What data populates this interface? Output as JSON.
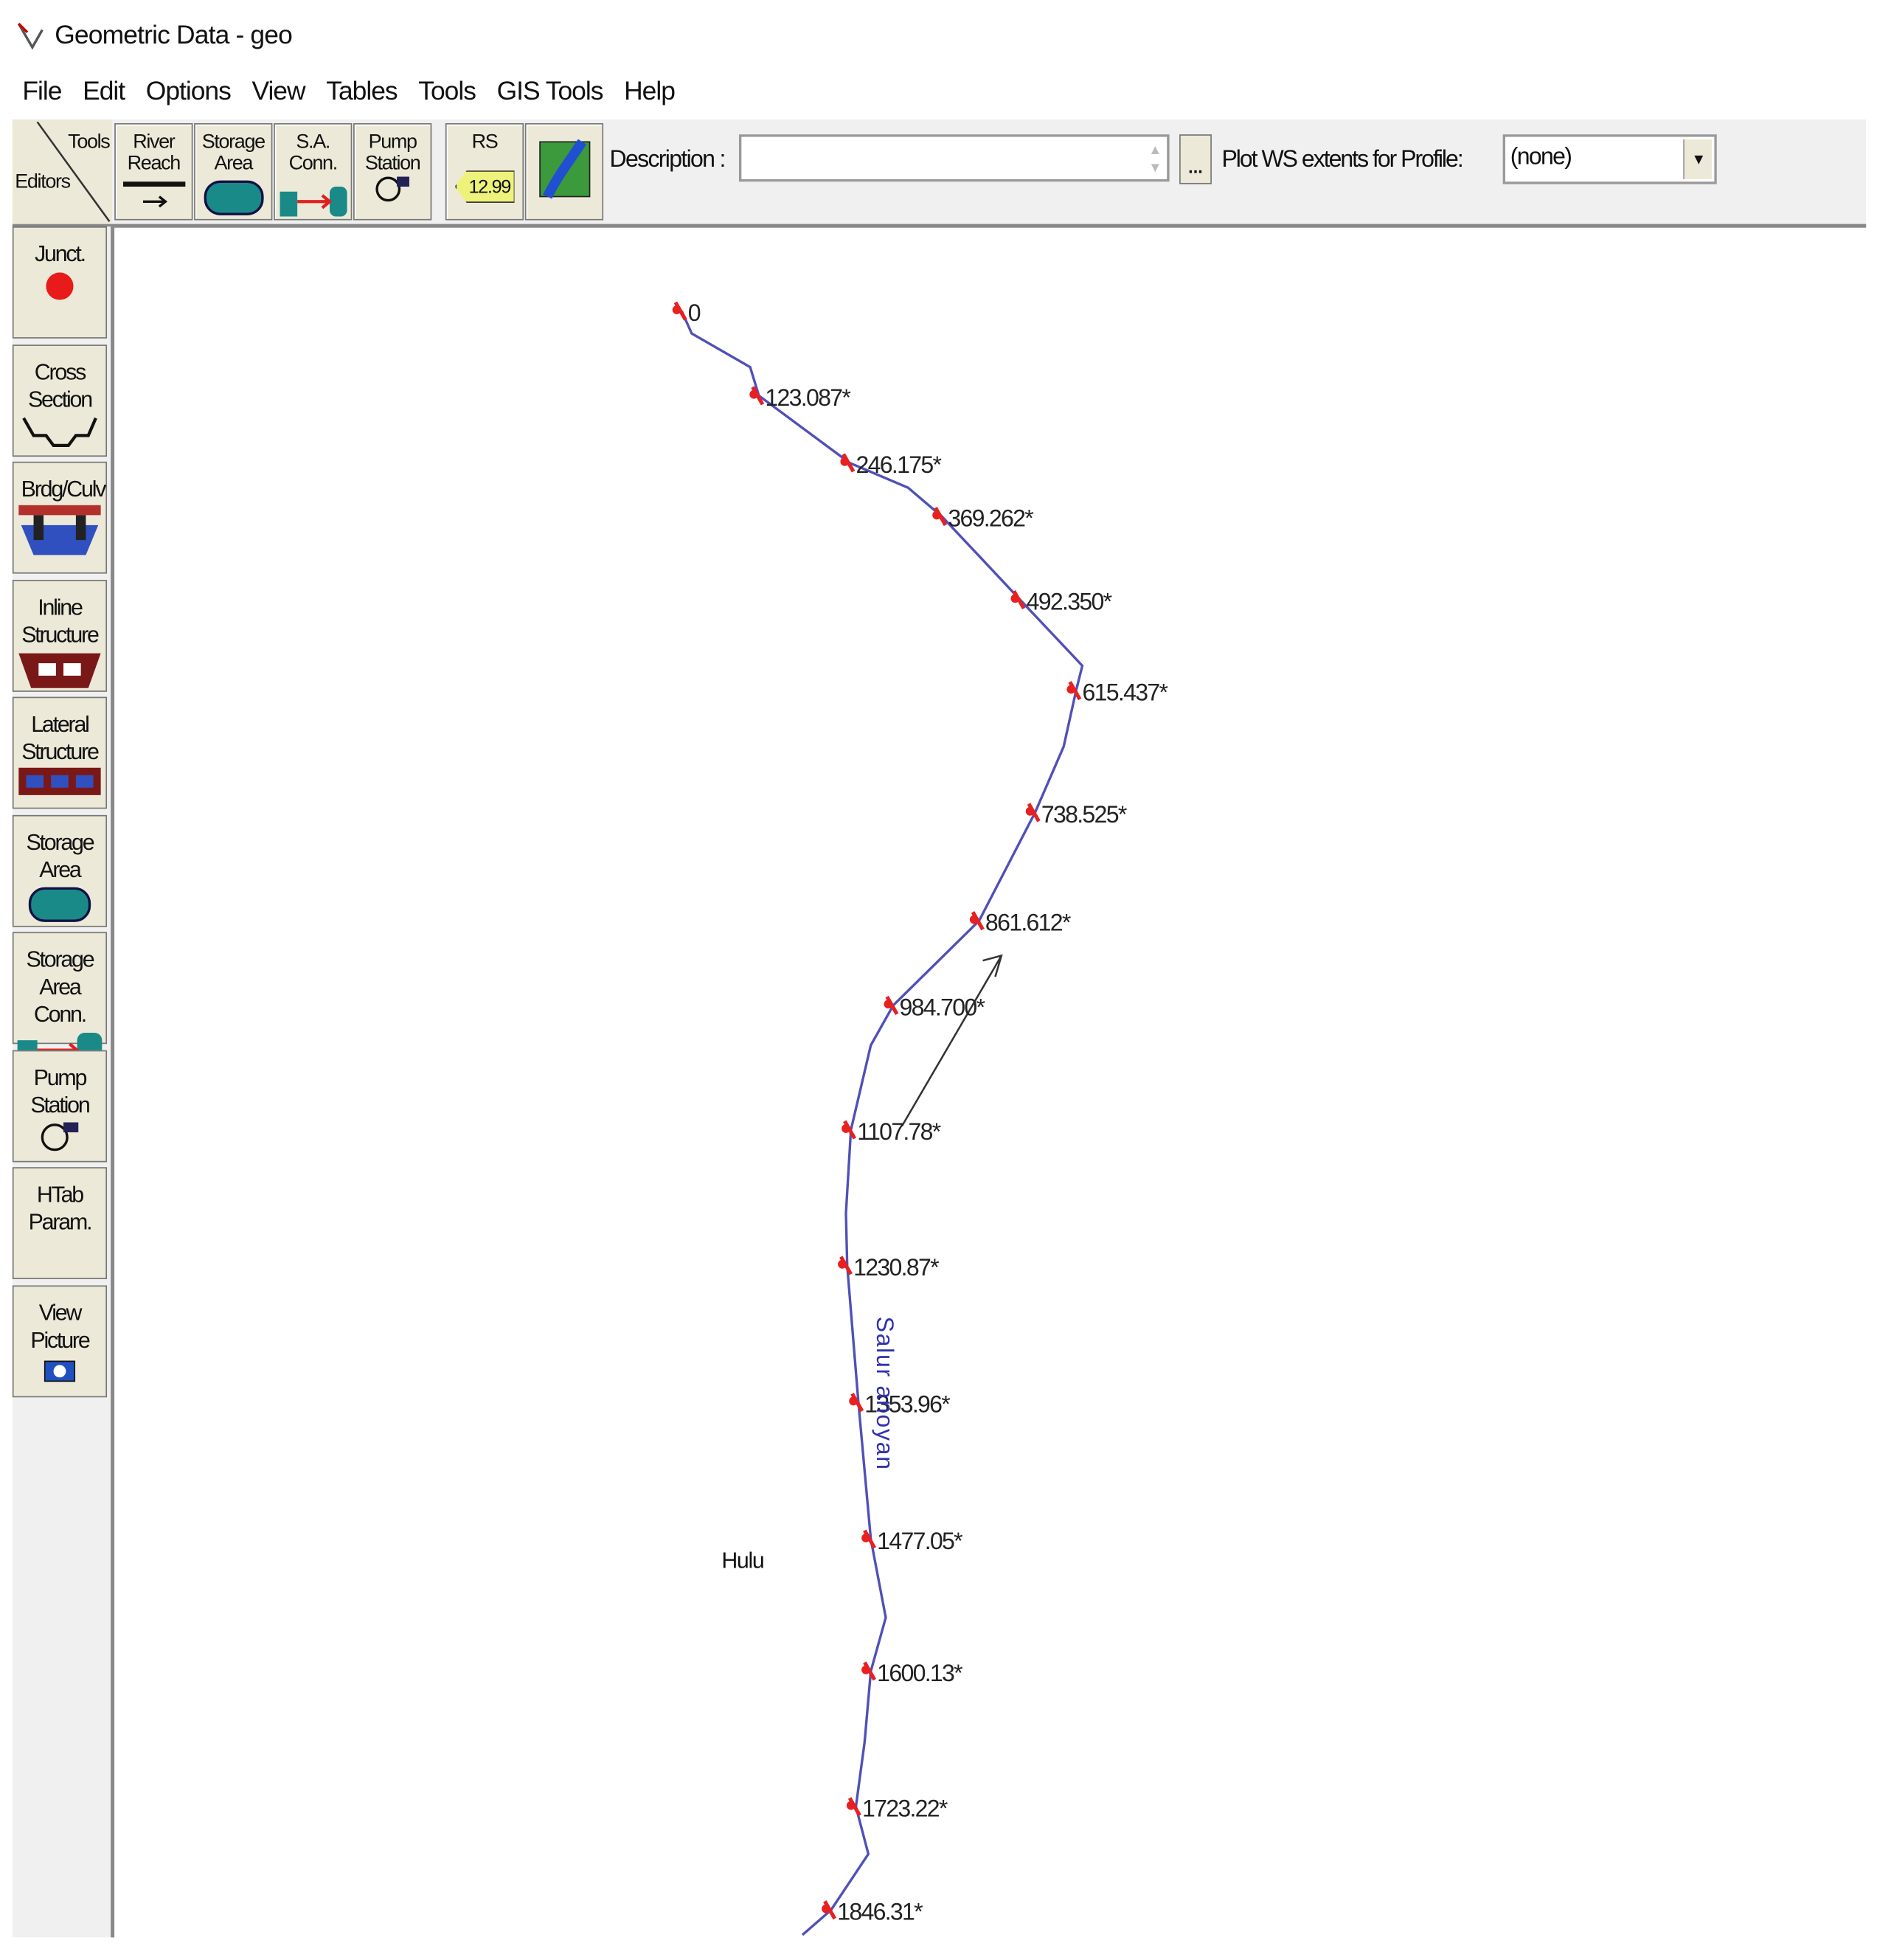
{
  "window": {
    "title": "Geometric Data - geo"
  },
  "menu": [
    "File",
    "Edit",
    "Options",
    "View",
    "Tables",
    "Tools",
    "GIS Tools",
    "Help"
  ],
  "toolbar": {
    "corner_tools": "Tools",
    "corner_editors": "Editors",
    "buttons": [
      {
        "label": "River Reach"
      },
      {
        "label": "Storage Area"
      },
      {
        "label": "S.A. Conn."
      },
      {
        "label": "Pump Station"
      },
      {
        "label": "RS",
        "tag": "12.99"
      }
    ],
    "description_label": "Description :",
    "description_value": "",
    "ellipsis": "...",
    "plot_label": "Plot WS extents for Profile:",
    "profile_selected": "(none)"
  },
  "palette": [
    {
      "label": "Junct."
    },
    {
      "label": "Cross Section"
    },
    {
      "label": "Brdg/Culv"
    },
    {
      "label": "Inline Structure"
    },
    {
      "label": "Lateral Structure"
    },
    {
      "label": "Storage Area"
    },
    {
      "label": "Storage Area Conn."
    },
    {
      "label": "Pump Station"
    },
    {
      "label": "HTab Param."
    },
    {
      "label": "View Picture"
    }
  ],
  "map": {
    "river_name": "Salur anoyan",
    "reach_name": "Hulu",
    "stations": [
      "0",
      "123.087*",
      "246.175*",
      "369.262*",
      "492.350*",
      "615.437*",
      "738.525*",
      "861.612*",
      "984.700*",
      "1107.78*",
      "1230.87*",
      "1353.96*",
      "1477.05*",
      "1600.13*",
      "1723.22*",
      "1846.31*"
    ],
    "colors": {
      "river": "#5050b8",
      "xs_marker": "#e82020"
    }
  }
}
